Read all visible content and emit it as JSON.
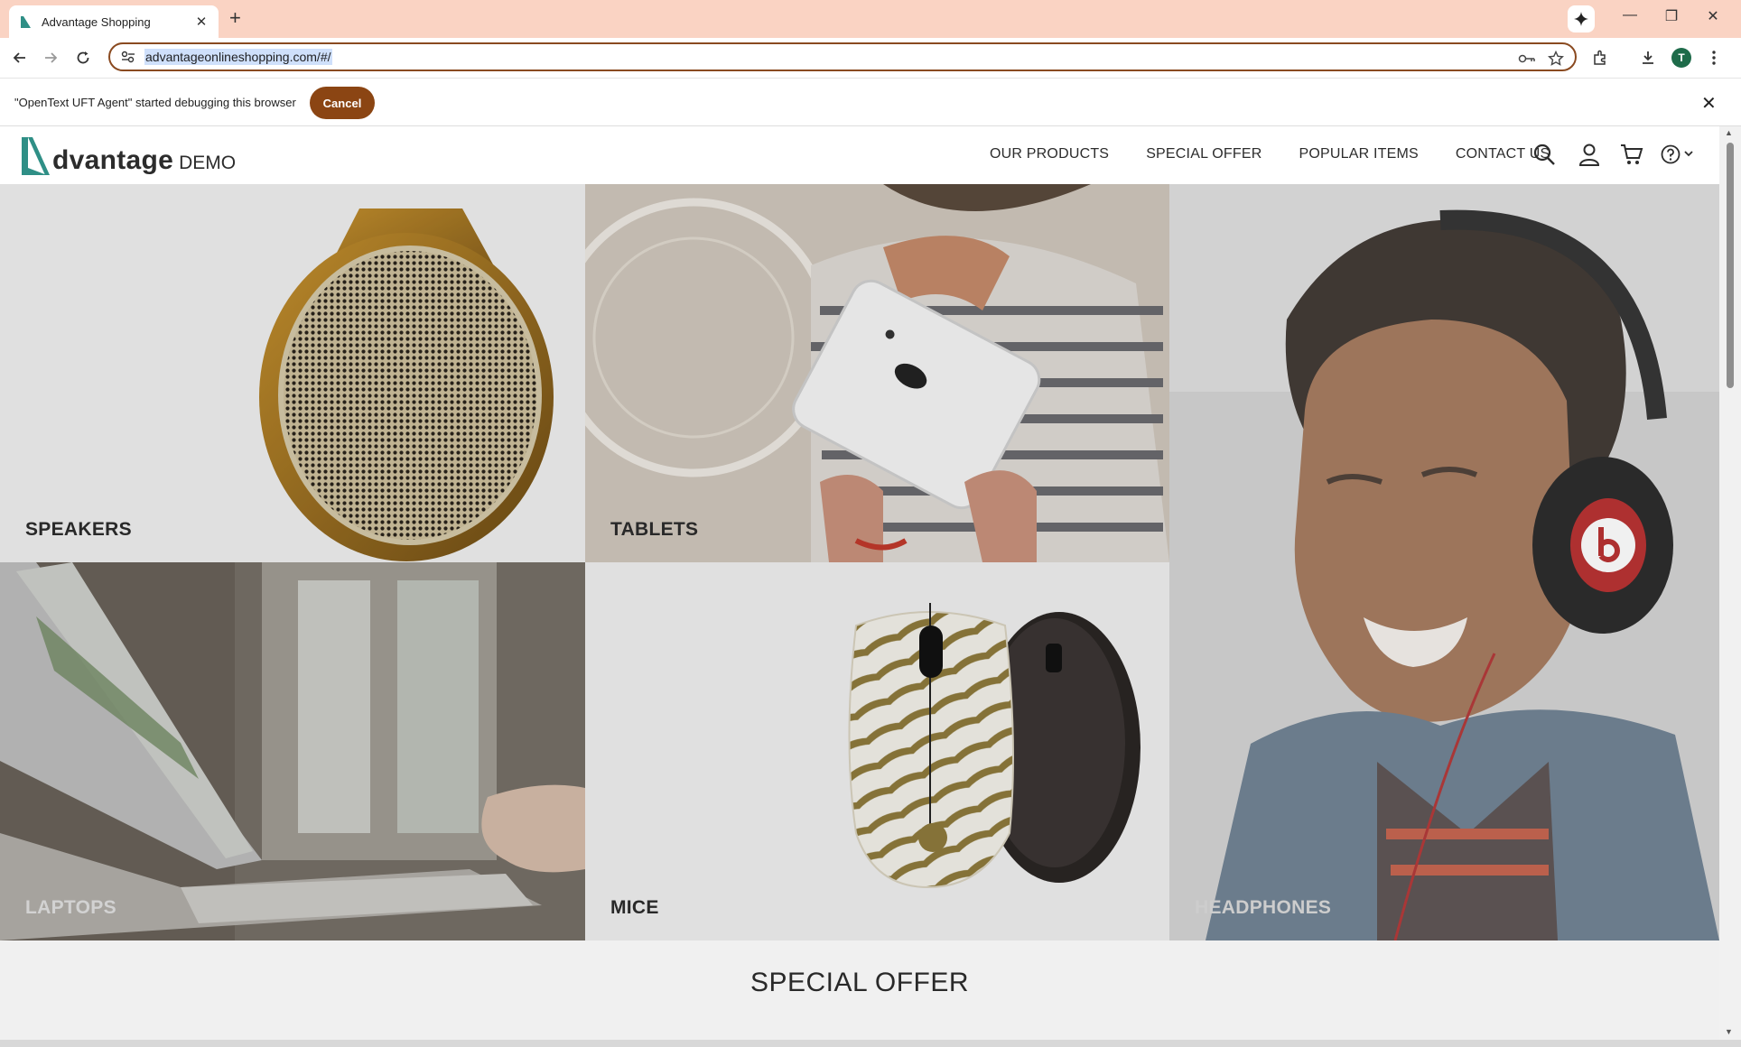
{
  "browser": {
    "tab_title": "Advantage Shopping",
    "url": "advantageonlineshopping.com/#/",
    "profile_initial": "T"
  },
  "infobar": {
    "message": "\"OpenText UFT Agent\" started debugging this browser",
    "cancel_label": "Cancel"
  },
  "site": {
    "logo_text": "dvantage",
    "logo_suffix": "DEMO",
    "nav": [
      "OUR PRODUCTS",
      "SPECIAL OFFER",
      "POPULAR ITEMS",
      "CONTACT US"
    ]
  },
  "categories": {
    "speakers": "SPEAKERS",
    "tablets": "TABLETS",
    "headphones": "HEADPHONES",
    "laptops": "LAPTOPS",
    "mice": "MICE"
  },
  "section_title": "SPECIAL OFFER",
  "colors": {
    "tab_strip": "#fad3c3",
    "omnibox_border": "#8a4a20",
    "cancel_button": "#8b4513",
    "brand_teal": "#2f8f86"
  }
}
